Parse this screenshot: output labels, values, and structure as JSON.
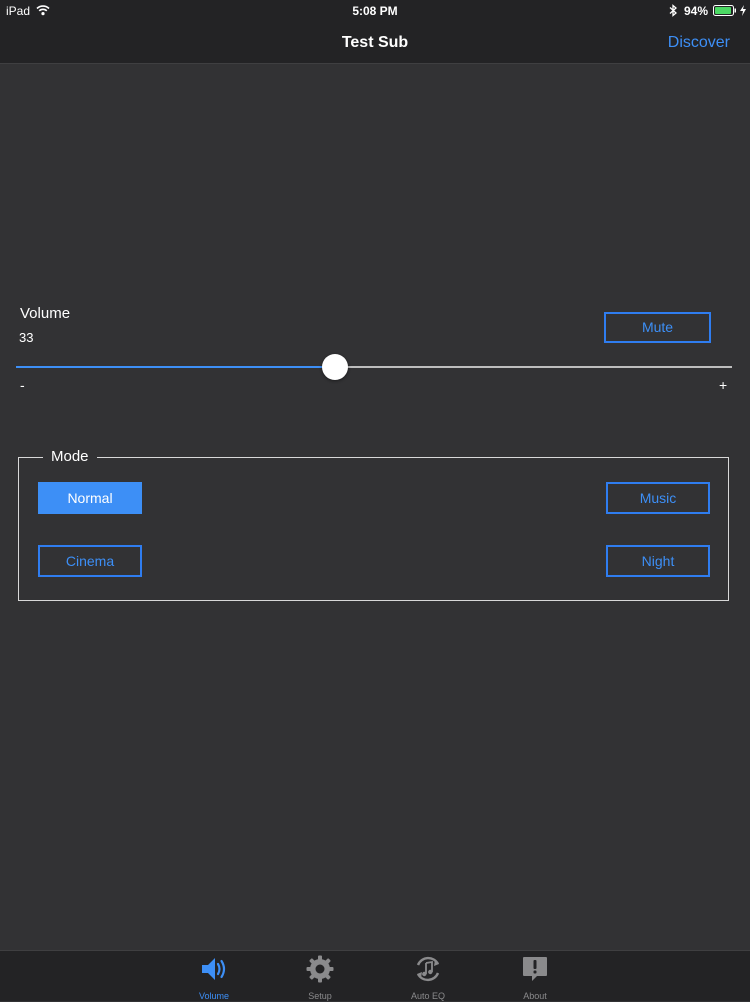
{
  "status_bar": {
    "device": "iPad",
    "time": "5:08 PM",
    "battery_percent": "94%",
    "battery_level": 0.94
  },
  "nav": {
    "title": "Test Sub",
    "right_button": "Discover"
  },
  "volume": {
    "label": "Volume",
    "value": "33",
    "level_fraction": 0.445,
    "mute_label": "Mute",
    "min_symbol": "-",
    "max_symbol": "+"
  },
  "mode": {
    "legend": "Mode",
    "options": [
      {
        "label": "Normal",
        "selected": true
      },
      {
        "label": "Music",
        "selected": false
      },
      {
        "label": "Cinema",
        "selected": false
      },
      {
        "label": "Night",
        "selected": false
      }
    ]
  },
  "tabs": [
    {
      "label": "Volume",
      "icon": "speaker-icon",
      "active": true
    },
    {
      "label": "Setup",
      "icon": "gear-icon",
      "active": false
    },
    {
      "label": "Auto EQ",
      "icon": "auto-eq-icon",
      "active": false
    },
    {
      "label": "About",
      "icon": "about-icon",
      "active": false
    }
  ],
  "colors": {
    "accent": "#3d8ff6",
    "background": "#323234",
    "bar": "#232325",
    "battery": "#4cd964"
  }
}
